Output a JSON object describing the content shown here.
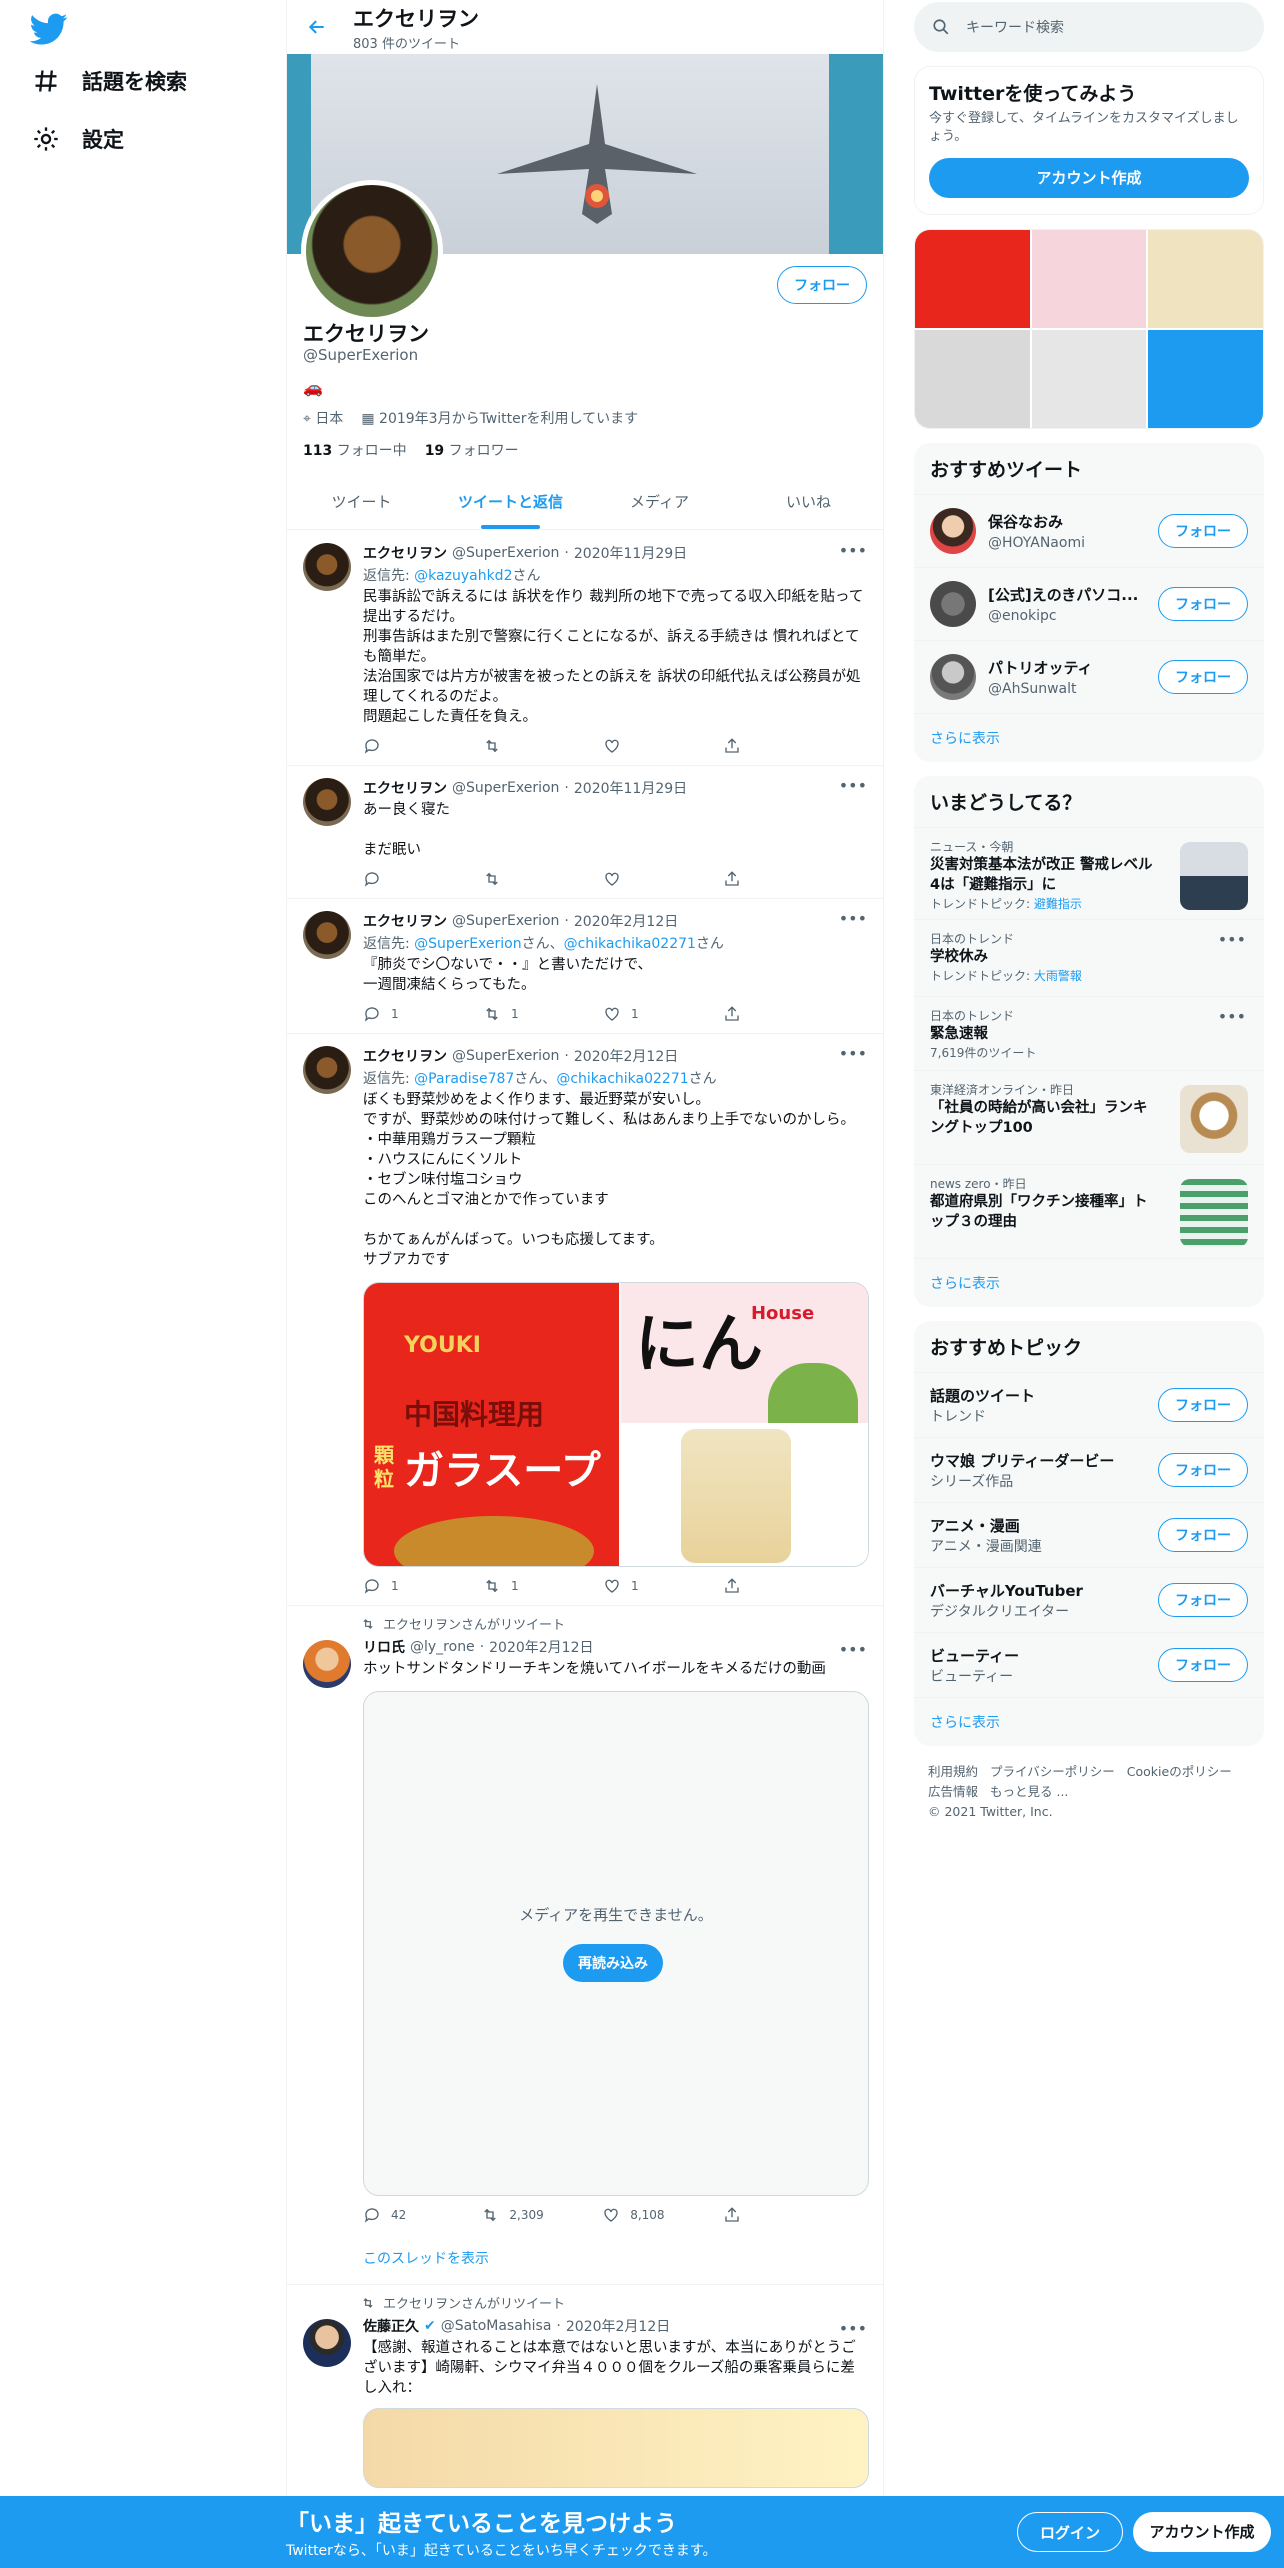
{
  "colors": {
    "accent": "#1d9bf0",
    "text": "#0f1419",
    "muted": "#536471"
  },
  "nav": {
    "explore_label": "話題を検索",
    "settings_label": "設定"
  },
  "header": {
    "name": "エクセリヲン",
    "tweet_count": "803 件のツイート"
  },
  "profile": {
    "name": "エクセリヲン",
    "handle": "@SuperExerion",
    "bio_emoji": "🚗",
    "location": "日本",
    "joined": "2019年3月からTwitterを利用しています",
    "following_count": "113",
    "following_label": "フォロー中",
    "followers_count": "19",
    "followers_label": "フォロワー",
    "follow_label": "フォロー"
  },
  "tabs": [
    "ツイート",
    "ツイートと返信",
    "メディア",
    "いいね"
  ],
  "tweets": [
    {
      "name": "エクセリヲン",
      "handle": "@SuperExerion",
      "date": "2020年11月29日",
      "reply_prefix": "返信先:",
      "reply_to": "@kazuyahkd2",
      "reply_suffix": "さん",
      "text": "民事訴訟で訴えるには 訴状を作り 裁判所の地下で売ってる収入印紙を貼って提出するだけ。\n刑事告訴はまた別で警察に行くことになるが、訴える手続きは 慣れればとても簡単だ。\n法治国家では片方が被害を被ったとの訴えを 訴状の印紙代払えば公務員が処理してくれるのだよ。\n問題起こした責任を負え。",
      "replies": "",
      "retweets": "",
      "likes": ""
    },
    {
      "name": "エクセリヲン",
      "handle": "@SuperExerion",
      "date": "2020年11月29日",
      "text": "あー良く寝た\n\nまだ眠い",
      "replies": "",
      "retweets": "",
      "likes": ""
    },
    {
      "name": "エクセリヲン",
      "handle": "@SuperExerion",
      "date": "2020年2月12日",
      "reply_prefix": "返信先:",
      "reply_to": "@SuperExerion",
      "reply_mid": "さん、",
      "reply_to2": "@chikachika02271",
      "reply_suffix": "さん",
      "text": "『肺炎でシ〇ないで・・』と書いただけで、\n一週間凍結くらってもた。",
      "replies": "1",
      "retweets": "1",
      "likes": "1"
    },
    {
      "name": "エクセリヲン",
      "handle": "@SuperExerion",
      "date": "2020年2月12日",
      "reply_prefix": "返信先:",
      "reply_to": "@Paradise787",
      "reply_mid": "さん、",
      "reply_to2": "@chikachika02271",
      "reply_suffix": "さん",
      "text": "ぼくも野菜炒めをよく作ります、最近野菜が安いし。\nですが、野菜炒めの味付けって難しく、私はあんまり上手でないのかしら。\n・中華用鶏ガラスープ顆粒\n・ハウスにんにくソルト\n・セブン味付塩コショウ\nこのへんとゴマ油とかで作っています\n\nちかてぁんがんばって。いつも応援してます。\nサブアカです",
      "media_text_1": "中国料理用",
      "media_text_2": "顆粒",
      "media_text_3": "ガラスープ",
      "media_text_4": "YOUKI",
      "media_text_5": "にん",
      "media_text_6": "House",
      "replies": "1",
      "retweets": "1",
      "likes": "1"
    },
    {
      "rt_label": "エクセリヲンさんがリツイート",
      "name": "リロ氏",
      "handle": "@ly_rone",
      "date": "2020年2月12日",
      "text": "ホットサンドタンドリーチキンを焼いてハイボールをキメるだけの動画",
      "video_msg": "メディアを再生できません。",
      "video_btn": "再読み込み",
      "replies": "42",
      "retweets": "2,309",
      "likes": "8,108",
      "thread": "このスレッドを表示"
    },
    {
      "rt_label": "エクセリヲンさんがリツイート",
      "name": "佐藤正久",
      "handle": "@SatoMasahisa",
      "date": "2020年2月12日",
      "text": "【感謝、報道されることは本意ではないと思いますが、本当にありがとうございます】崎陽軒、シウマイ弁当４０００個をクルーズ船の乗客乗員らに差し入れ："
    }
  ],
  "right": {
    "search_placeholder": "キーワード検索",
    "signup_title": "Twitterを使ってみよう",
    "signup_text": "今すぐ登録して、タイムラインをカスタマイズしましょう。",
    "signup_btn": "アカウント作成",
    "rec_title": "おすすめツイート",
    "rec_users": [
      {
        "name": "保谷なおみ",
        "handle": "@HOYANaomi"
      },
      {
        "name": "[公式]えのきパソコ...",
        "handle": "@enokipc"
      },
      {
        "name": "パトリオッティ",
        "handle": "@AhSunwalt"
      }
    ],
    "follow_label": "フォロー",
    "more_label": "さらに表示",
    "trends_title": "いまどうしてる？",
    "trends": [
      {
        "meta": "ニュース・今朝",
        "title": "災害対策基本法が改正 警戒レベル4は「避難指示」に",
        "sub_prefix": "トレンドトピック: ",
        "sub_link": "避難指示"
      },
      {
        "meta": "日本のトレンド",
        "title": "学校休み",
        "sub_prefix": "トレンドトピック: ",
        "sub_link": "大雨警報"
      },
      {
        "meta": "日本のトレンド",
        "title": "緊急速報",
        "sub_prefix": "7,619件のツイート",
        "sub_link": ""
      },
      {
        "meta": "東洋経済オンライン・昨日",
        "title": "「社員の時給が高い会社」ランキングトップ100",
        "sub_prefix": "",
        "sub_link": ""
      },
      {
        "meta": "news zero・昨日",
        "title": "都道府県別「ワクチン接種率」トップ３の理由",
        "sub_prefix": "",
        "sub_link": ""
      }
    ],
    "topics_title": "おすすめトピック",
    "topics": [
      {
        "name": "話題のツイート",
        "cat": "トレンド"
      },
      {
        "name": "ウマ娘 プリティーダービー",
        "cat": "シリーズ作品"
      },
      {
        "name": "アニメ・漫画",
        "cat": "アニメ・漫画関連"
      },
      {
        "name": "バーチャルYouTuber",
        "cat": "デジタルクリエイター"
      },
      {
        "name": "ビューティー",
        "cat": "ビューティー"
      }
    ],
    "footer": [
      "利用規約",
      "プライバシーポリシー",
      "Cookieのポリシー",
      "広告情報",
      "もっと見る ...",
      "© 2021 Twitter, Inc."
    ]
  },
  "bottombar": {
    "headline": "「いま」起きていることを見つけよう",
    "sub": "Twitterなら、「いま」起きていることをいち早くチェックできます。",
    "login": "ログイン",
    "signup": "アカウント作成"
  }
}
